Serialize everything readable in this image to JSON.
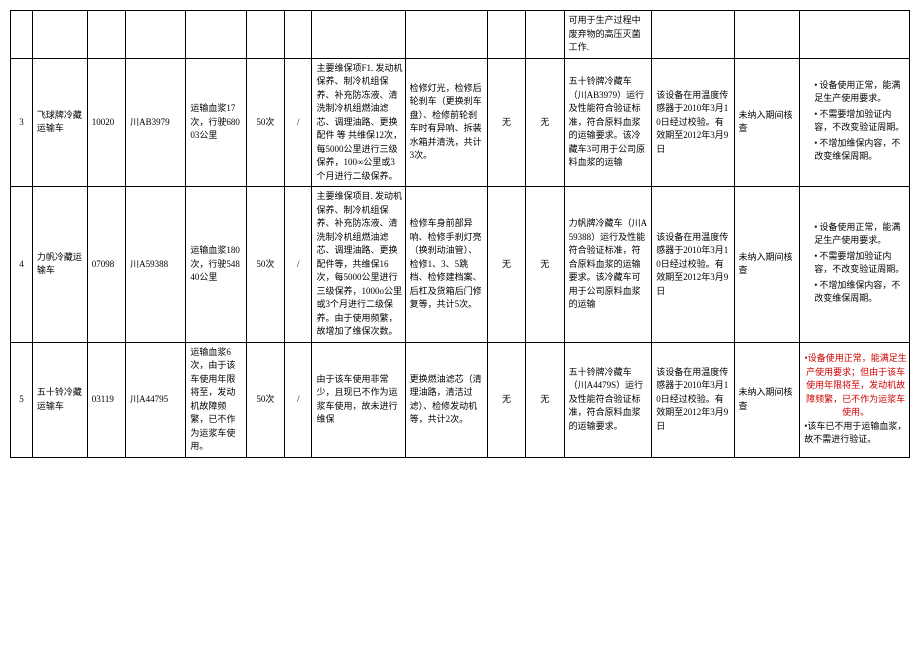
{
  "rows": [
    {
      "idx": "",
      "name": "",
      "code": "",
      "plate": "",
      "usage": "",
      "count50": "",
      "slash": "",
      "maintenance": "",
      "repair": "",
      "no1": "",
      "no2": "",
      "evaluation": "可用于生产过程中废弃物的高压灭菌工作.",
      "calibration": "",
      "check": "",
      "conclusion_items": []
    },
    {
      "idx": "3",
      "name": "飞球牌冷藏运输车",
      "code": "10020",
      "plate": "川AB3979",
      "usage": "运输血浆17次，行驶68003公里",
      "count50": "50次",
      "slash": "/",
      "maintenance": "主要维保项F1. 发动机保养、制冷机组保养、补充防冻液、清洗制冷机组燃油滤芯、调理油路、更换配件 等 共维保12次，每5000公里进行三级保养，100∞公里或3个月进行二级保养。",
      "repair": "检修灯光，检修后轮刹车（更换刹车盘）、检修前轮刹车时有异响、拆装水箱并清洗，共计3次。",
      "no1": "无",
      "no2": "无",
      "evaluation": "五十铃牌冷藏车（川AB3979）运行及性能符合验证标准，符合原料血浆的运输要求。该冷藏车3可用于公司原料血浆的运输",
      "calibration": "该设备在用温度传感器于2010年3月10日经过校验。有效期至2012年3月9日",
      "check": "未纳入期间核查",
      "conclusion_items": [
        "设备使用正常，能满足生产使用要求。",
        "不需要增加验证内容，不改变验证周期。",
        "不增加维保内容，不改变维保周期。"
      ]
    },
    {
      "idx": "4",
      "name": "力帆冷藏运输车",
      "code": "07098",
      "plate": "川A59388",
      "usage": "运输血浆180次，行驶54840公里",
      "count50": "50次",
      "slash": "/",
      "maintenance": "主要维保项目. 发动机保养、制冷机组保养、补充防冻液、清洗制冷机组燃油滤芯、调理油路、更换配件等，共维保16次，每5000公里进行三级保养，1000o公里或3个月进行二级保养。由于使用频繁，故增加了维保次数。",
      "repair": "检修车身前部异响、检修手刹灯亮（换刹动油管）、检修1、3、5跳档、检修建档案、后杠及货箱后门修复等，共计5次。",
      "no1": "无",
      "no2": "无",
      "evaluation": "力帆牌冷藏车（川A59388）运行及性能符合验证标准，符合原料血浆的运输要求。该冷藏车可用于公司原料血浆的运输",
      "calibration": "该设备在用温度传感器于2010年3月10日经过校验。有效期至2012年3月9日",
      "check": "未纳入期间核查",
      "conclusion_items": [
        "设备使用正常，能满足生产使用要求。",
        "不需要增加验证内容，不改变验证周期。",
        "不增加维保内容，不改变维保周期。"
      ]
    },
    {
      "idx": "5",
      "name": "五十铃冷藏运输车",
      "code": "03119",
      "plate": "川A44795",
      "usage": "运输血浆6次，由于该车使用年限将至，发动机故障频繁，已不作为运浆车使用。",
      "count50": "50次",
      "slash": "/",
      "maintenance": "由于该车使用非常少，且现已不作为运浆车使用，故未进行维保",
      "repair": "更换燃油滤芯（清理油路，清洁过滤）、检修发动机等，共计2次。",
      "no1": "无",
      "no2": "无",
      "evaluation": "五十铃牌冷藏车（川A4479S）运行及性能符合验证标准，符合原料血浆的运输要求。",
      "calibration": "该设备在用温度传感器于2010年3月10日经过校验。有效期至2012年3月9日",
      "check": "未纳入期间核查",
      "conclusion_items": [],
      "conclusion_red": "•设备使用正常，能满足生产使用要求；但由于该车使用年限将至，发动机故障频繁，已不作为运浆车使用。",
      "conclusion_after": "•该车已不用于运输血浆，故不需进行验证。"
    }
  ]
}
